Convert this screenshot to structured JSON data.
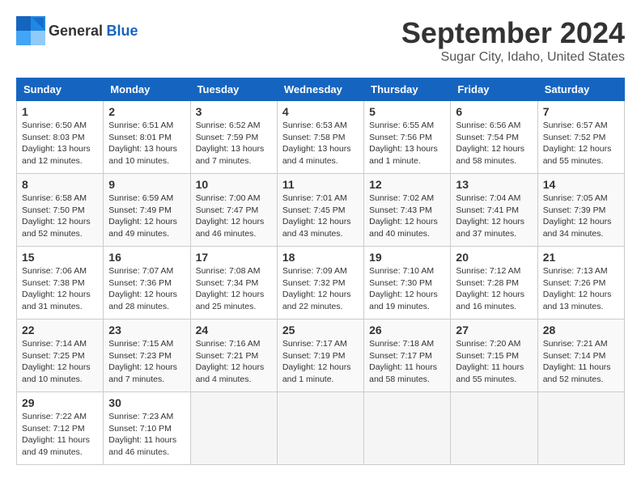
{
  "header": {
    "logo_general": "General",
    "logo_blue": "Blue",
    "month_title": "September 2024",
    "location": "Sugar City, Idaho, United States"
  },
  "days_of_week": [
    "Sunday",
    "Monday",
    "Tuesday",
    "Wednesday",
    "Thursday",
    "Friday",
    "Saturday"
  ],
  "weeks": [
    [
      {
        "day": "1",
        "info": "Sunrise: 6:50 AM\nSunset: 8:03 PM\nDaylight: 13 hours\nand 12 minutes."
      },
      {
        "day": "2",
        "info": "Sunrise: 6:51 AM\nSunset: 8:01 PM\nDaylight: 13 hours\nand 10 minutes."
      },
      {
        "day": "3",
        "info": "Sunrise: 6:52 AM\nSunset: 7:59 PM\nDaylight: 13 hours\nand 7 minutes."
      },
      {
        "day": "4",
        "info": "Sunrise: 6:53 AM\nSunset: 7:58 PM\nDaylight: 13 hours\nand 4 minutes."
      },
      {
        "day": "5",
        "info": "Sunrise: 6:55 AM\nSunset: 7:56 PM\nDaylight: 13 hours\nand 1 minute."
      },
      {
        "day": "6",
        "info": "Sunrise: 6:56 AM\nSunset: 7:54 PM\nDaylight: 12 hours\nand 58 minutes."
      },
      {
        "day": "7",
        "info": "Sunrise: 6:57 AM\nSunset: 7:52 PM\nDaylight: 12 hours\nand 55 minutes."
      }
    ],
    [
      {
        "day": "8",
        "info": "Sunrise: 6:58 AM\nSunset: 7:50 PM\nDaylight: 12 hours\nand 52 minutes."
      },
      {
        "day": "9",
        "info": "Sunrise: 6:59 AM\nSunset: 7:49 PM\nDaylight: 12 hours\nand 49 minutes."
      },
      {
        "day": "10",
        "info": "Sunrise: 7:00 AM\nSunset: 7:47 PM\nDaylight: 12 hours\nand 46 minutes."
      },
      {
        "day": "11",
        "info": "Sunrise: 7:01 AM\nSunset: 7:45 PM\nDaylight: 12 hours\nand 43 minutes."
      },
      {
        "day": "12",
        "info": "Sunrise: 7:02 AM\nSunset: 7:43 PM\nDaylight: 12 hours\nand 40 minutes."
      },
      {
        "day": "13",
        "info": "Sunrise: 7:04 AM\nSunset: 7:41 PM\nDaylight: 12 hours\nand 37 minutes."
      },
      {
        "day": "14",
        "info": "Sunrise: 7:05 AM\nSunset: 7:39 PM\nDaylight: 12 hours\nand 34 minutes."
      }
    ],
    [
      {
        "day": "15",
        "info": "Sunrise: 7:06 AM\nSunset: 7:38 PM\nDaylight: 12 hours\nand 31 minutes."
      },
      {
        "day": "16",
        "info": "Sunrise: 7:07 AM\nSunset: 7:36 PM\nDaylight: 12 hours\nand 28 minutes."
      },
      {
        "day": "17",
        "info": "Sunrise: 7:08 AM\nSunset: 7:34 PM\nDaylight: 12 hours\nand 25 minutes."
      },
      {
        "day": "18",
        "info": "Sunrise: 7:09 AM\nSunset: 7:32 PM\nDaylight: 12 hours\nand 22 minutes."
      },
      {
        "day": "19",
        "info": "Sunrise: 7:10 AM\nSunset: 7:30 PM\nDaylight: 12 hours\nand 19 minutes."
      },
      {
        "day": "20",
        "info": "Sunrise: 7:12 AM\nSunset: 7:28 PM\nDaylight: 12 hours\nand 16 minutes."
      },
      {
        "day": "21",
        "info": "Sunrise: 7:13 AM\nSunset: 7:26 PM\nDaylight: 12 hours\nand 13 minutes."
      }
    ],
    [
      {
        "day": "22",
        "info": "Sunrise: 7:14 AM\nSunset: 7:25 PM\nDaylight: 12 hours\nand 10 minutes."
      },
      {
        "day": "23",
        "info": "Sunrise: 7:15 AM\nSunset: 7:23 PM\nDaylight: 12 hours\nand 7 minutes."
      },
      {
        "day": "24",
        "info": "Sunrise: 7:16 AM\nSunset: 7:21 PM\nDaylight: 12 hours\nand 4 minutes."
      },
      {
        "day": "25",
        "info": "Sunrise: 7:17 AM\nSunset: 7:19 PM\nDaylight: 12 hours\nand 1 minute."
      },
      {
        "day": "26",
        "info": "Sunrise: 7:18 AM\nSunset: 7:17 PM\nDaylight: 11 hours\nand 58 minutes."
      },
      {
        "day": "27",
        "info": "Sunrise: 7:20 AM\nSunset: 7:15 PM\nDaylight: 11 hours\nand 55 minutes."
      },
      {
        "day": "28",
        "info": "Sunrise: 7:21 AM\nSunset: 7:14 PM\nDaylight: 11 hours\nand 52 minutes."
      }
    ],
    [
      {
        "day": "29",
        "info": "Sunrise: 7:22 AM\nSunset: 7:12 PM\nDaylight: 11 hours\nand 49 minutes."
      },
      {
        "day": "30",
        "info": "Sunrise: 7:23 AM\nSunset: 7:10 PM\nDaylight: 11 hours\nand 46 minutes."
      },
      {
        "day": "",
        "info": ""
      },
      {
        "day": "",
        "info": ""
      },
      {
        "day": "",
        "info": ""
      },
      {
        "day": "",
        "info": ""
      },
      {
        "day": "",
        "info": ""
      }
    ]
  ]
}
